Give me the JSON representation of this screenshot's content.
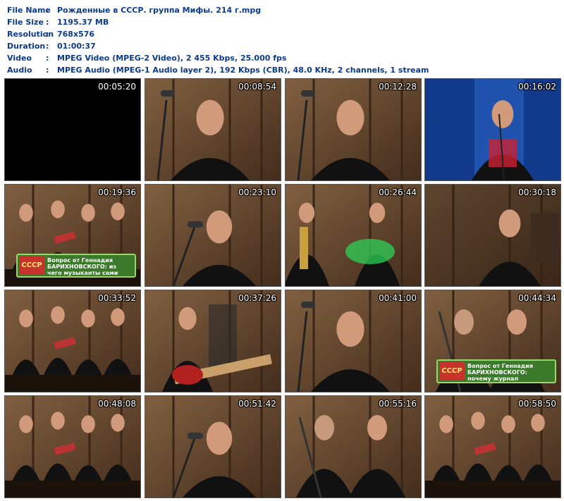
{
  "file_info": [
    {
      "key": "File Name",
      "value": "Рожденные в СССР. группа Мифы. 214 г.mpg"
    },
    {
      "key": "File Size",
      "value": "1195.37 MB"
    },
    {
      "key": "Resolution",
      "value": "768x576"
    },
    {
      "key": "Duration",
      "value": "01:00:37"
    },
    {
      "key": "Video",
      "value": "MPEG Video (MPEG-2 Video), 2 455 Kbps, 25.000 fps"
    },
    {
      "key": "Audio",
      "value": "MPEG Audio (MPEG-1 Audio layer 2), 192 Kbps (CBR), 48.0 KHz, 2 channels, 1 stream"
    }
  ],
  "separator": ":",
  "thumbnails": [
    {
      "time": "00:05:20",
      "scene": "black"
    },
    {
      "time": "00:08:54",
      "scene": "closeup"
    },
    {
      "time": "00:12:28",
      "scene": "closeup"
    },
    {
      "time": "00:16:02",
      "scene": "concert"
    },
    {
      "time": "00:19:36",
      "scene": "band-caption",
      "caption": "Вопрос от Геннадия БАРИХНОВСКОГО: из чего музыканты сами делали медиатор?",
      "logo": "СССР"
    },
    {
      "time": "00:23:10",
      "scene": "singer-mic"
    },
    {
      "time": "00:26:44",
      "scene": "band-green"
    },
    {
      "time": "00:30:18",
      "scene": "seated"
    },
    {
      "time": "00:33:52",
      "scene": "band"
    },
    {
      "time": "00:37:26",
      "scene": "guitarist"
    },
    {
      "time": "00:41:00",
      "scene": "closeup"
    },
    {
      "time": "00:44:34",
      "scene": "duo-caption",
      "caption": "Вопрос от Геннадия БАРИХНОВСКОГО: почему журнал \"Кругозор\" был так популярен?",
      "logo": "СССР"
    },
    {
      "time": "00:48:08",
      "scene": "band"
    },
    {
      "time": "00:51:42",
      "scene": "singer-mic"
    },
    {
      "time": "00:55:16",
      "scene": "duo"
    },
    {
      "time": "00:58:50",
      "scene": "band"
    }
  ]
}
